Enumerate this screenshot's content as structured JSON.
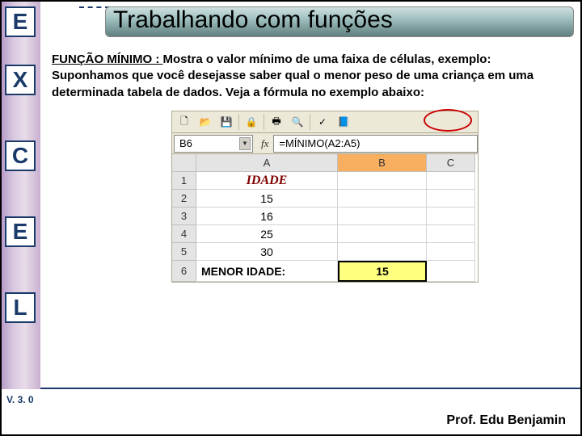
{
  "sidebar": {
    "letters": [
      "E",
      "X",
      "C",
      "E",
      "L"
    ]
  },
  "title": "Trabalhando com funções",
  "body": {
    "label": "FUNÇÃO MÍNIMO : ",
    "text": "Mostra o valor mínimo de uma faixa de células, exemplo: Suponhamos que você desejasse saber qual o menor peso de uma criança em uma determinada tabela de dados. Veja a fórmula no exemplo abaixo:"
  },
  "toolbar_icons": [
    {
      "name": "new-doc-icon",
      "glyph": "🗋"
    },
    {
      "name": "open-icon",
      "glyph": "📂"
    },
    {
      "name": "save-icon",
      "glyph": "💾"
    },
    {
      "name": "sep"
    },
    {
      "name": "permission-icon",
      "glyph": "🔒"
    },
    {
      "name": "sep"
    },
    {
      "name": "print-icon",
      "glyph": "🖶"
    },
    {
      "name": "preview-icon",
      "glyph": "🔍"
    },
    {
      "name": "sep"
    },
    {
      "name": "spell-icon",
      "glyph": "✓"
    },
    {
      "name": "research-icon",
      "glyph": "📘"
    }
  ],
  "excel": {
    "namebox": "B6",
    "fx_label": "fx",
    "formula": "=MÍNIMO(A2:A5)",
    "cols": [
      "A",
      "B",
      "C"
    ],
    "rows": [
      {
        "n": "1",
        "a": "IDADE",
        "b": "",
        "a_class": "idade center"
      },
      {
        "n": "2",
        "a": "15",
        "b": "",
        "a_class": "center"
      },
      {
        "n": "3",
        "a": "16",
        "b": "",
        "a_class": "center"
      },
      {
        "n": "4",
        "a": "25",
        "b": "",
        "a_class": "center"
      },
      {
        "n": "5",
        "a": "30",
        "b": "",
        "a_class": "center"
      }
    ],
    "row6": {
      "n": "6",
      "a": "MENOR IDADE:",
      "b": "15"
    }
  },
  "version": "V. 3. 0",
  "footer": "Prof. Edu Benjamin"
}
